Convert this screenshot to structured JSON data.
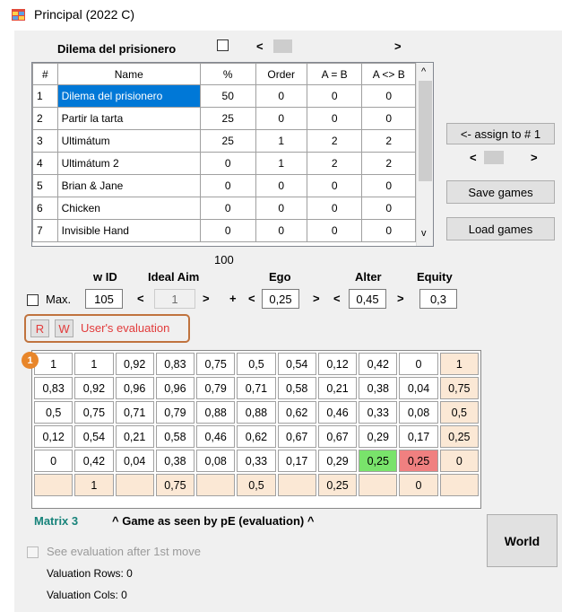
{
  "window": {
    "title": "Principal (2022 C)",
    "icon": "app-window-icon"
  },
  "game_header": {
    "label": "Dilema del prisionero",
    "scroll_left": "<",
    "scroll_right": ">"
  },
  "games_table": {
    "columns": [
      "#",
      "Name",
      "%",
      "Order",
      "A = B",
      "A <> B"
    ],
    "rows": [
      [
        "1",
        "Dilema del prisionero",
        "50",
        "0",
        "0",
        "0"
      ],
      [
        "2",
        "Partir la tarta",
        "25",
        "0",
        "0",
        "0"
      ],
      [
        "3",
        "Ultimátum",
        "25",
        "1",
        "2",
        "2"
      ],
      [
        "4",
        "Ultimátum 2",
        "0",
        "1",
        "2",
        "2"
      ],
      [
        "5",
        "Brian & Jane",
        "0",
        "0",
        "0",
        "0"
      ],
      [
        "6",
        "Chicken",
        "0",
        "0",
        "0",
        "0"
      ],
      [
        "7",
        "Invisible Hand",
        "0",
        "0",
        "0",
        "0"
      ]
    ],
    "selected_row": 0,
    "scroll_up": "^",
    "scroll_down": "v"
  },
  "right_panel": {
    "assign_label": "<- assign to # 1",
    "nav_left": "<",
    "nav_right": ">",
    "save_label": "Save games",
    "load_label": "Load games"
  },
  "params": {
    "total": "100",
    "headers": {
      "wid": "w ID",
      "ideal_aim": "Ideal Aim",
      "ego": "Ego",
      "alter": "Alter",
      "equity": "Equity"
    },
    "max_label": "Max.",
    "wid_value": "105",
    "ideal_aim_value": "1",
    "plus": "+",
    "ego_value": "0,25",
    "alter_value": "0,45",
    "equity_value": "0,3",
    "left": "<",
    "right": ">"
  },
  "evaluation": {
    "r_label": "R",
    "w_label": "W",
    "text": "User's evaluation"
  },
  "badge": "1",
  "matrix": {
    "rows": [
      [
        "1",
        "1",
        "0,92",
        "0,83",
        "0,75",
        "0,5",
        "0,54",
        "0,12",
        "0,42",
        "0",
        "1"
      ],
      [
        "0,83",
        "0,92",
        "0,96",
        "0,96",
        "0,79",
        "0,71",
        "0,58",
        "0,21",
        "0,38",
        "0,04",
        "0,75"
      ],
      [
        "0,5",
        "0,75",
        "0,71",
        "0,79",
        "0,88",
        "0,88",
        "0,62",
        "0,46",
        "0,33",
        "0,08",
        "0,5"
      ],
      [
        "0,12",
        "0,54",
        "0,21",
        "0,58",
        "0,46",
        "0,62",
        "0,67",
        "0,67",
        "0,29",
        "0,17",
        "0,25"
      ],
      [
        "0",
        "0,42",
        "0,04",
        "0,38",
        "0,08",
        "0,33",
        "0,17",
        "0,29",
        "0,25",
        "0,25",
        "0"
      ],
      [
        "",
        "1",
        "",
        "0,75",
        "",
        "0,5",
        "",
        "0,25",
        "",
        "0",
        ""
      ]
    ],
    "colors": {
      "tan": "#fbe8d5",
      "green": "#79e36b",
      "red": "#f08080"
    }
  },
  "footer": {
    "matrix_label": "Matrix 3",
    "caption": "^ Game as seen by pE (evaluation) ^",
    "see_eval_label": "See evaluation after 1st move",
    "val_rows": "Valuation Rows: 0",
    "val_cols": "Valuation Cols: 0",
    "world_label": "World"
  }
}
